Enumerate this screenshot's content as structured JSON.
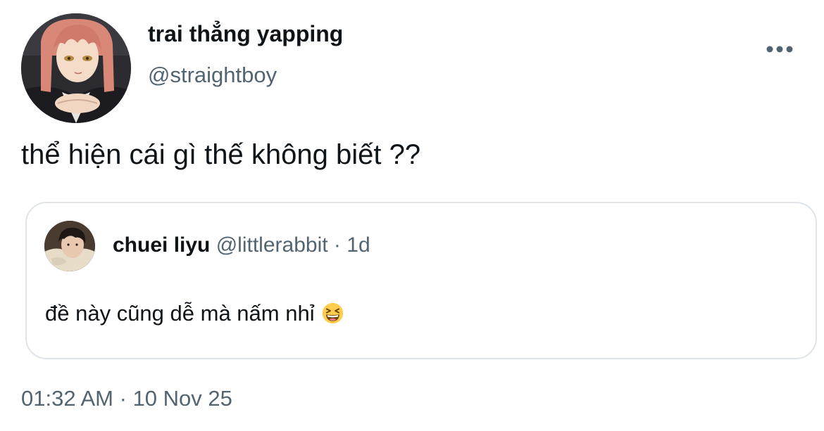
{
  "author": {
    "display_name": "trai thẳng yapping",
    "handle": "@straightboy",
    "avatar_icon": "anime-character-avatar"
  },
  "more_icon": "more-horizontal-icon",
  "tweet": {
    "text": "thể hiện cái gì thế không biết ??"
  },
  "quoted_tweet": {
    "display_name": "chuei liyu",
    "handle": "@littlerabbit",
    "separator": "·",
    "time": "1d",
    "text": "đề này cũng dễ mà nấm nhỉ",
    "emoji": "grinning-squinting-face-emoji",
    "avatar_icon": "user-photo-avatar"
  },
  "meta": {
    "time": "01:32 AM",
    "separator": "·",
    "date": "10 Nov 25"
  },
  "colors": {
    "text_primary": "#0f1419",
    "text_secondary": "#536471",
    "border": "#dfe4e9",
    "background": "#ffffff"
  }
}
